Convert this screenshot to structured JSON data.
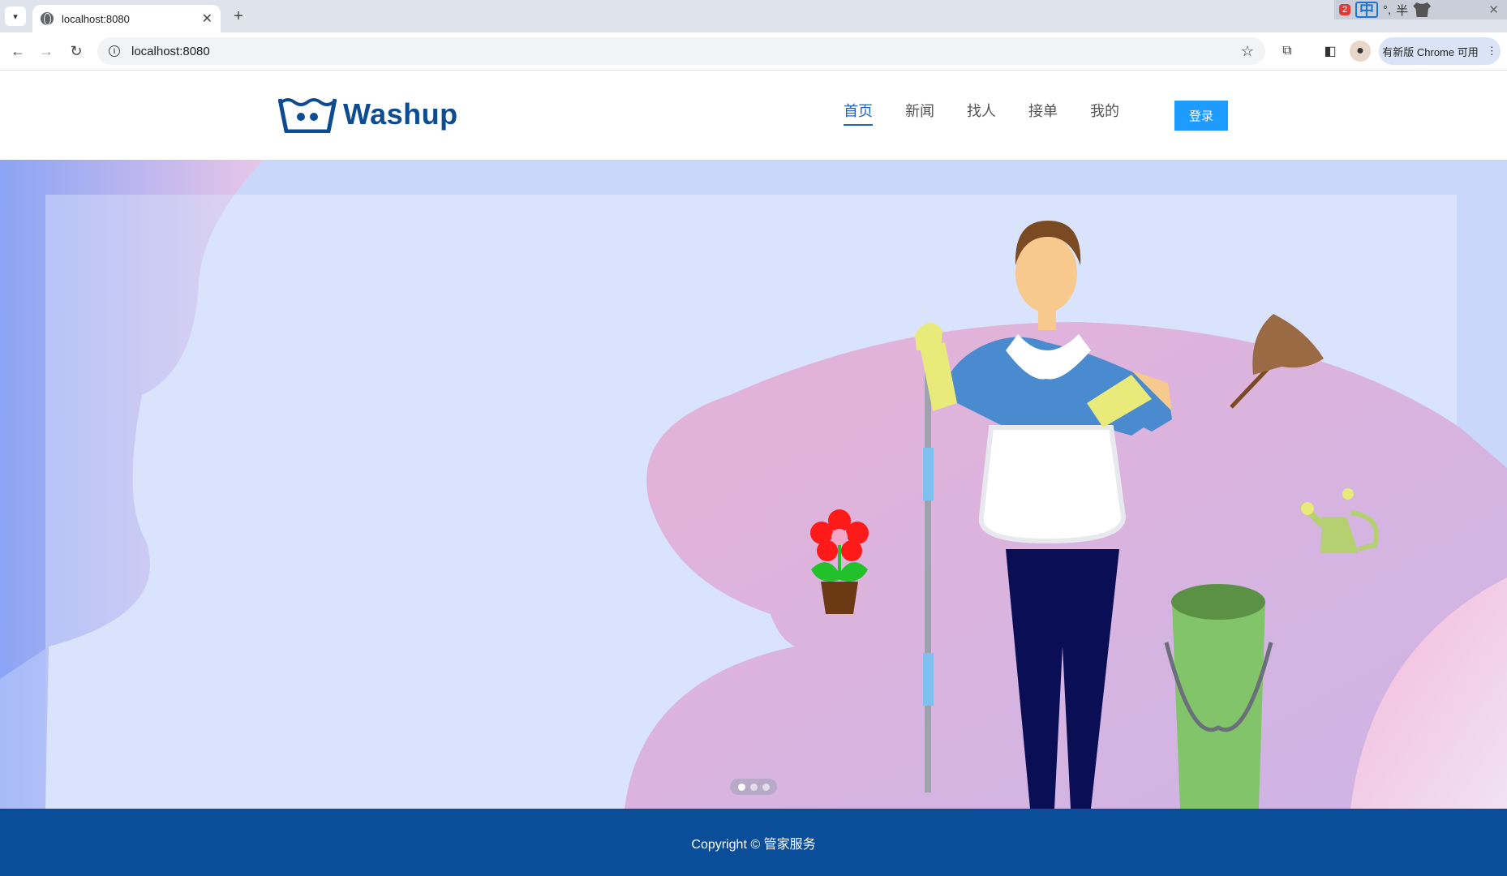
{
  "browser": {
    "tab_title": "localhost:8080",
    "url": "localhost:8080",
    "update_label": "有新版 Chrome 可用",
    "ime_badge": "2",
    "ime_mode": "中",
    "ime_punct": "°,",
    "ime_width": "半"
  },
  "site": {
    "logo_text": "Washup",
    "brand_color": "#0d4c93",
    "nav": [
      {
        "label": "首页",
        "active": true
      },
      {
        "label": "新闻",
        "active": false
      },
      {
        "label": "找人",
        "active": false
      },
      {
        "label": "接单",
        "active": false
      },
      {
        "label": "我的",
        "active": false
      }
    ],
    "login_label": "登录",
    "login_color": "#1e9bff"
  },
  "carousel": {
    "slide_count": 3,
    "active_index": 0,
    "image_description_icon": "housekeeper-illustration"
  },
  "footer": {
    "copyright": "Copyright © 管家服务"
  }
}
